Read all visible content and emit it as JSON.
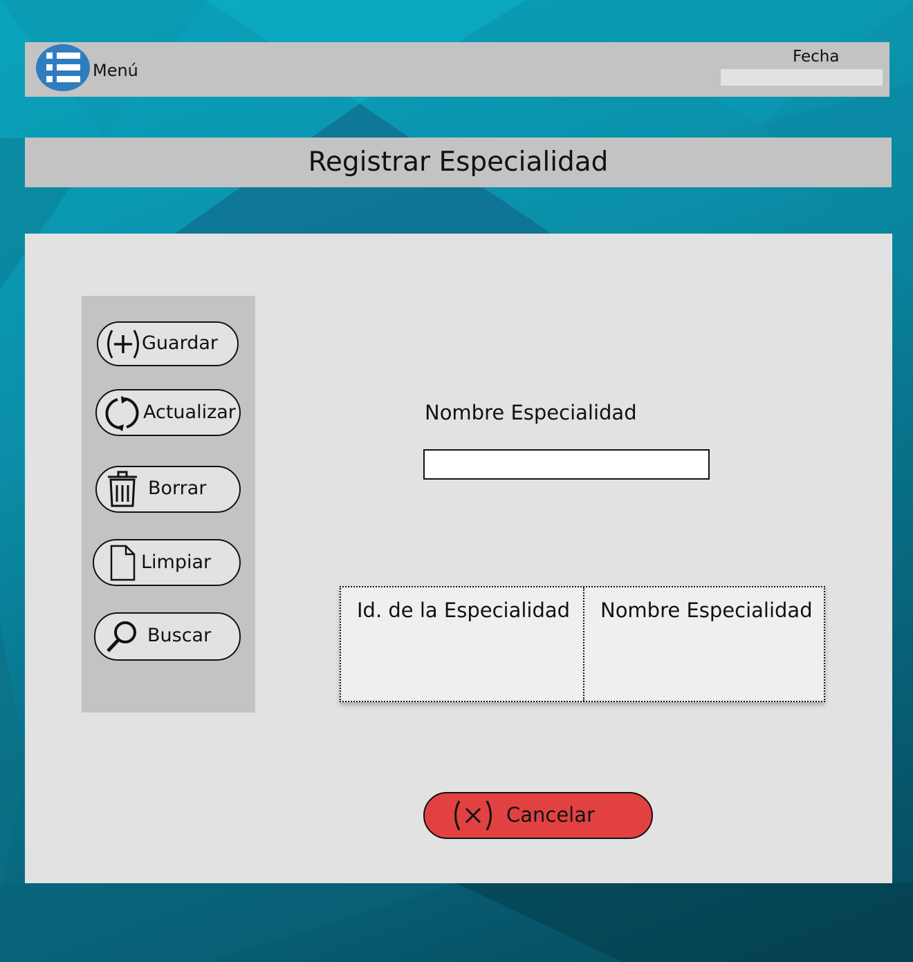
{
  "header": {
    "menu_label": "Menú",
    "date_label": "Fecha",
    "date_value": ""
  },
  "page": {
    "title": "Registrar Especialidad"
  },
  "toolbar": {
    "save_label": "Guardar",
    "update_label": "Actualizar",
    "delete_label": "Borrar",
    "clear_label": "Limpiar",
    "search_label": "Buscar"
  },
  "form": {
    "name_label": "Nombre Especialidad",
    "name_value": ""
  },
  "table": {
    "columns": [
      "Id. de la Especialidad",
      "Nombre Especialidad"
    ]
  },
  "actions": {
    "cancel_label": "Cancelar"
  },
  "colors": {
    "accent": "#2f7dbf",
    "cancel": "#e24141",
    "panel": "#e2e2e2",
    "bar": "#c3c3c3"
  },
  "icons": {
    "menu": "list-icon",
    "save": "plus-circle-icon",
    "update": "refresh-icon",
    "delete": "trash-icon",
    "clear": "document-icon",
    "search": "magnifier-icon",
    "cancel": "x-circle-icon"
  }
}
